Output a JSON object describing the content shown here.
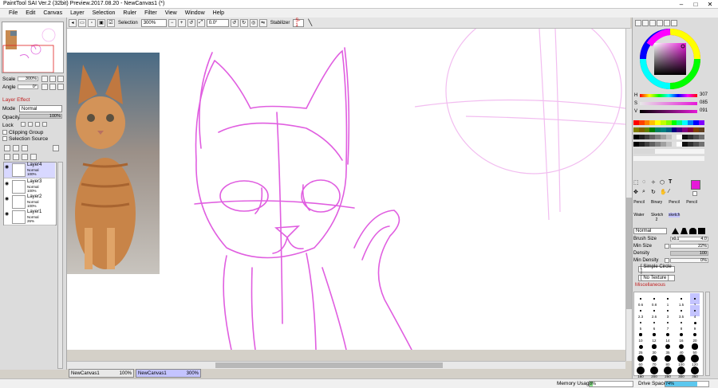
{
  "window": {
    "title": "PaintTool SAI Ver.2 (32bit) Preview.2017.08.20 - NewCanvas1 (*)",
    "minimize": "–",
    "maximize": "□",
    "close": "✕"
  },
  "menu": [
    "File",
    "Edit",
    "Canvas",
    "Layer",
    "Selection",
    "Ruler",
    "Filter",
    "View",
    "Window",
    "Help"
  ],
  "toolbar": {
    "selection_label": "Selection",
    "zoom": "300%",
    "rotation": "0.0°",
    "stabilizer_label": "Stabilizer",
    "stabilizer_value": "S-1"
  },
  "navigator": {
    "scale_label": "Scale",
    "scale_value": "300%",
    "angle_label": "Angle",
    "angle_value": "0°"
  },
  "layer_panel": {
    "effect_label": "Layer Effect",
    "mode_label": "Mode",
    "mode_value": "Normal",
    "opacity_label": "Opacity",
    "opacity_value": "100%",
    "lock_label": "Lock",
    "clipping_label": "Clipping Group",
    "selection_source_label": "Selection Source",
    "layers": [
      {
        "name": "Layer4",
        "mode": "Normal",
        "opacity": "100%"
      },
      {
        "name": "Layer3",
        "mode": "Normal",
        "opacity": "100%"
      },
      {
        "name": "Layer2",
        "mode": "Normal",
        "opacity": "100%"
      },
      {
        "name": "Layer1",
        "mode": "Normal",
        "opacity": "26%"
      }
    ]
  },
  "tabs": [
    {
      "name": "NewCanvas1",
      "zoom": "100%"
    },
    {
      "name": "NewCanvas1",
      "zoom": "300%"
    }
  ],
  "status": {
    "memory_label": "Memory Usage",
    "memory_value": "8%",
    "memory_fraction": 0.08,
    "drive_label": "Drive Space",
    "drive_value": "74%",
    "drive_fraction": 0.74
  },
  "color": {
    "h_label": "H",
    "h_value": "307",
    "s_label": "S",
    "s_value": "085",
    "v_label": "V",
    "v_value": "091",
    "current": "#e619d8"
  },
  "tools": {
    "brushes": [
      [
        "Pencil",
        "Binary",
        "Pencil",
        "Pencil"
      ],
      [
        "Water",
        "Sketch 2",
        "sketch",
        ""
      ]
    ],
    "blend_mode": "Normal",
    "brush_size_label": "Brush Size",
    "brush_size_mult": "x0.1",
    "brush_size_value": "4.0",
    "min_size_label": "Min Size",
    "min_size_value": "22%",
    "density_label": "Density",
    "density_value": "100",
    "min_density_label": "Min Density",
    "min_density_value": "0%",
    "shape": "[ Simple Circle ]",
    "texture": "[ No Texture ]",
    "misc_label": "Miscellaneous",
    "preset_sizes": [
      "0.6",
      "0.8",
      "1",
      "1.5",
      "2",
      "2.3",
      "2.6",
      "3",
      "3.5",
      "4",
      "5",
      "6",
      "7",
      "8",
      "9",
      "10",
      "12",
      "14",
      "16",
      "20",
      "25",
      "30",
      "35",
      "40",
      "50",
      "60",
      "70",
      "80",
      "100",
      "120",
      "160",
      "200",
      "250",
      "300",
      "350"
    ]
  }
}
